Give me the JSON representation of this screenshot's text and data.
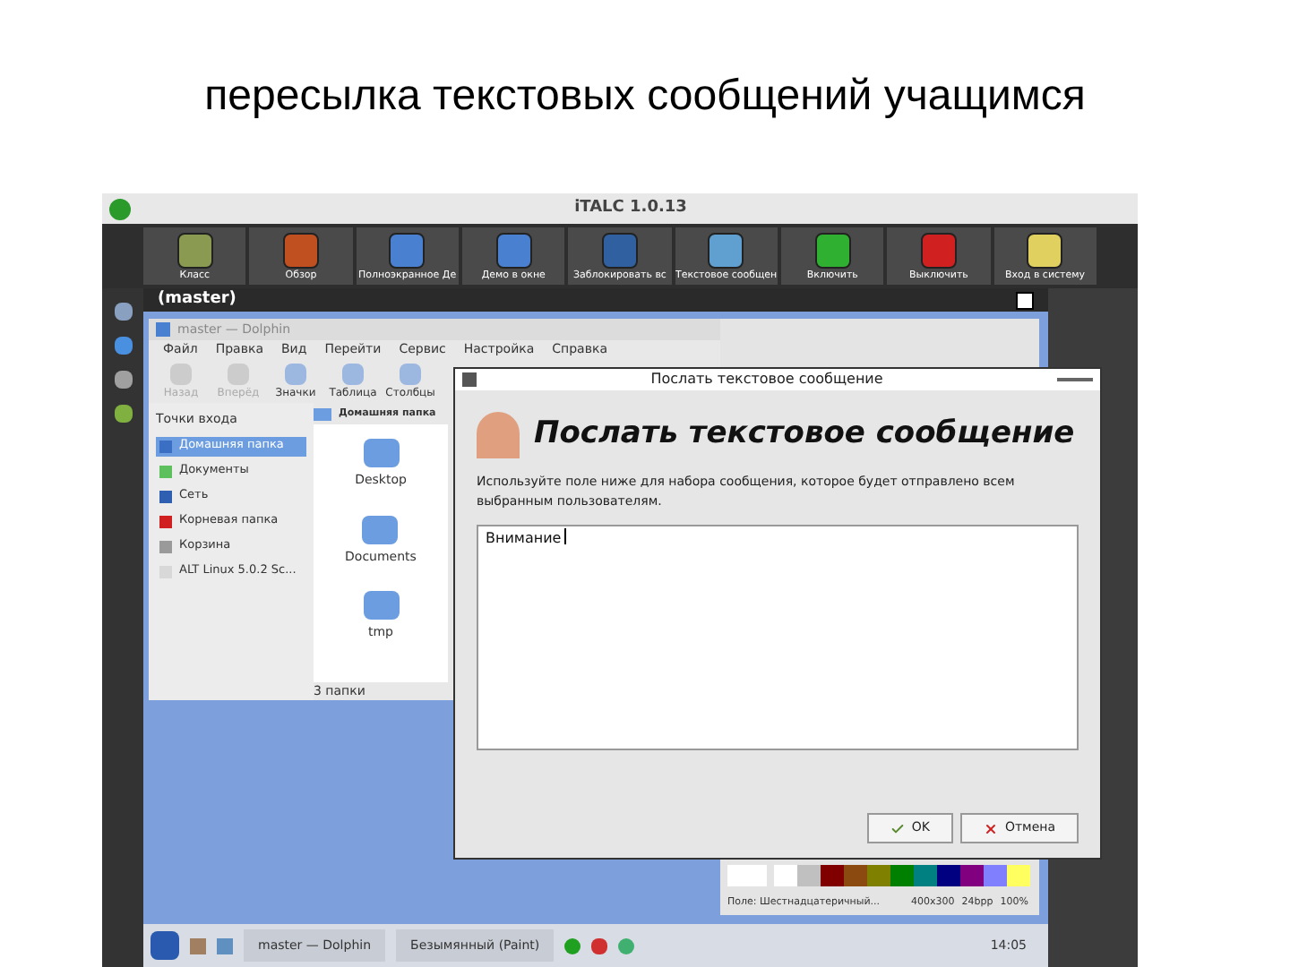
{
  "slide_title": "пересылка текстовых сообщений учащимся",
  "window": {
    "title": "iTALC 1.0.13"
  },
  "toolbar": [
    {
      "label": "Класс"
    },
    {
      "label": "Обзор"
    },
    {
      "label": "Полноэкранное Де"
    },
    {
      "label": "Демо в окне"
    },
    {
      "label": "Заблокировать вс"
    },
    {
      "label": "Текстовое сообщен"
    },
    {
      "label": "Включить"
    },
    {
      "label": "Выключить"
    },
    {
      "label": "Вход в систему"
    }
  ],
  "remote": {
    "title": "(master)",
    "dolphin": {
      "title": "master — Dolphin",
      "menu": [
        "Файл",
        "Правка",
        "Вид",
        "Перейти",
        "Сервис",
        "Настройка",
        "Справка"
      ],
      "tools": [
        {
          "label": "Назад",
          "disabled": true
        },
        {
          "label": "Вперёд",
          "disabled": true
        },
        {
          "label": "Значки",
          "disabled": false
        },
        {
          "label": "Таблица",
          "disabled": false
        },
        {
          "label": "Столбцы",
          "disabled": false
        }
      ],
      "places_title": "Точки входа",
      "places": [
        {
          "label": "Домашняя папка",
          "selected": true,
          "color": "#3a6fc4"
        },
        {
          "label": "Документы",
          "selected": false,
          "color": "#5cc05c"
        },
        {
          "label": "Сеть",
          "selected": false,
          "color": "#2f5fb0"
        },
        {
          "label": "Корневая папка",
          "selected": false,
          "color": "#d02020"
        },
        {
          "label": "Корзина",
          "selected": false,
          "color": "#9a9a9a"
        },
        {
          "label": "ALT Linux 5.0.2 Sc...",
          "selected": false,
          "color": "#d8d8d8"
        }
      ],
      "breadcrumb": "Домашняя папка",
      "files": [
        "Desktop",
        "Documents",
        "tmp"
      ],
      "status": "3 папки"
    },
    "paint": {
      "palette": [
        {
          "color": "#ffffff"
        },
        {
          "color": "#c0c0c0"
        },
        {
          "color": "#800000"
        },
        {
          "color": "#8a4a10"
        },
        {
          "color": "#808000"
        },
        {
          "color": "#008000"
        },
        {
          "color": "#008080"
        },
        {
          "color": "#000080"
        },
        {
          "color": "#800080"
        },
        {
          "color": "#8080ff"
        },
        {
          "color": "#ffff60"
        }
      ],
      "status": "Поле: Шестнадцатеричный...",
      "size": "400x300",
      "depth": "24bpp",
      "zoom": "100%"
    },
    "taskbar": {
      "tasks": [
        "master — Dolphin",
        "Безымянный (Paint)"
      ],
      "clock": "14:05"
    }
  },
  "dialog": {
    "title": "Послать текстовое сообщение",
    "heading": "Послать текстовое сообщение",
    "description": "Используйте поле ниже для набора сообщения, которое будет отправлено всем выбранным пользователям.",
    "message": "Внимание",
    "buttons": [
      {
        "kind": "ok",
        "label": "OK"
      },
      {
        "kind": "cancel",
        "label": "Отмена"
      }
    ]
  }
}
